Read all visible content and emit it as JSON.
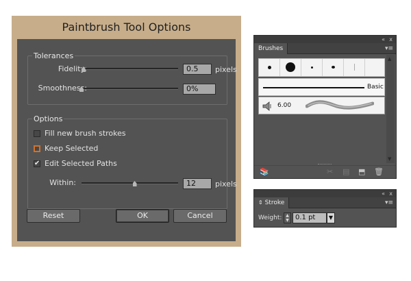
{
  "dialog": {
    "title": "Paintbrush Tool Options",
    "tolerances": {
      "legend": "Tolerances",
      "fidelity": {
        "label": "Fidelity:",
        "value": "0.5",
        "unit": "pixels",
        "slider_level": 0.02
      },
      "smoothness": {
        "label": "Smoothness:",
        "value": "0%",
        "slider_level": 0.0
      }
    },
    "options": {
      "legend": "Options",
      "fill_new": {
        "label": "Fill new brush strokes",
        "checked": false
      },
      "keep_selected": {
        "label": "Keep Selected",
        "checked": false
      },
      "edit_selected": {
        "label": "Edit Selected Paths",
        "checked": true
      },
      "within": {
        "label": "Within:",
        "value": "12",
        "unit": "pixels",
        "slider_level": 0.55
      }
    },
    "buttons": {
      "reset": "Reset",
      "ok": "OK",
      "cancel": "Cancel"
    }
  },
  "brushes_panel": {
    "tab": "Brushes",
    "basic_label": "Basic",
    "art_brush_size": "6.00",
    "topbar_icons": {
      "collapse": "«",
      "close": "x"
    },
    "menu_icon": "▾≡"
  },
  "stroke_panel": {
    "tab": "Stroke",
    "weight_label": "Weight:",
    "weight_value": "0.1 pt",
    "topbar_icons": {
      "collapse": "«",
      "close": "x"
    },
    "menu_icon": "▾≡"
  },
  "icons": {
    "check": "✔",
    "tab_arrows": "⇕",
    "dropdown": "▼",
    "up": "▲",
    "down": "▼",
    "libraries": "📚",
    "remove_stroke": "✂",
    "brush_options": "▤",
    "new_brush": "⬒",
    "delete": "🗑"
  },
  "colors": {
    "frame": "#c7ad8a",
    "panel": "#535353",
    "focus": "#d0722c"
  }
}
